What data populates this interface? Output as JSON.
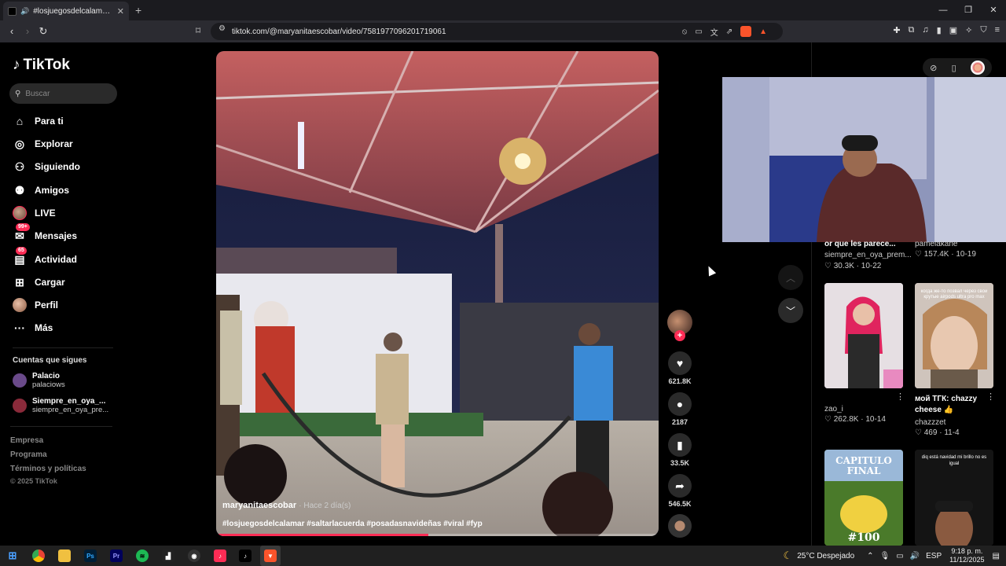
{
  "browser": {
    "tab_title": "#losjuegosdelcalamar #saltarlacuerda",
    "url": "tiktok.com/@maryanitaescobar/video/7581977096201719061",
    "shield_count": "1"
  },
  "sidebar": {
    "logo": "TikTok",
    "search_placeholder": "Buscar",
    "nav": [
      {
        "label": "Para ti",
        "icon": "home-icon"
      },
      {
        "label": "Explorar",
        "icon": "compass-icon"
      },
      {
        "label": "Siguiendo",
        "icon": "following-icon"
      },
      {
        "label": "Amigos",
        "icon": "friends-icon"
      },
      {
        "label": "LIVE",
        "icon": "live-icon"
      },
      {
        "label": "Mensajes",
        "icon": "messages-icon",
        "badge": "99+"
      },
      {
        "label": "Actividad",
        "icon": "activity-icon",
        "badge": "65"
      },
      {
        "label": "Cargar",
        "icon": "upload-icon"
      },
      {
        "label": "Perfil",
        "icon": "profile-icon"
      },
      {
        "label": "Más",
        "icon": "more-icon"
      }
    ],
    "following_title": "Cuentas que sigues",
    "following": [
      {
        "name": "Palacio",
        "handle": "palaciows"
      },
      {
        "name": "Siempre_en_oya_...",
        "handle": "siempre_en_oya_pre..."
      }
    ],
    "footer": [
      "Empresa",
      "Programa",
      "Términos y políticas"
    ],
    "copyright": "© 2025 TikTok"
  },
  "video": {
    "author": "maryanitaescobar",
    "time": "· Hace 2 día(s)",
    "caption": "#losjuegosdelcalamar #saltarlacuerda #posadasnavideñas #viral #fyp",
    "progress": 0.48
  },
  "actions": {
    "likes": "621.8K",
    "comments": "2187",
    "saves": "33.5K",
    "shares": "546.5K"
  },
  "recommended": [
    {
      "title": "or que les parece...",
      "author": "siempre_en_oya_prem...",
      "stats": "♡ 30.3K · 10-22"
    },
    {
      "title": "",
      "author": "pamelakane",
      "stats": "♡ 157.4K · 10-19"
    },
    {
      "title": "",
      "author": "zao_i",
      "stats": "♡ 262.8K · 10-14"
    },
    {
      "title": "мой ТГК: chazzy cheese 👍",
      "author": "chazzzet",
      "stats": "♡ 469 · 11-4"
    },
    {
      "thumb_text": "CAPITULO FINAL"
    },
    {
      "thumb_text": "diq está navidad mi brillo no es igual"
    }
  ],
  "thumb_captions": {
    "card4": "когда же-то позвал через свои крутые airpods ultra pro max",
    "card5_price": "100"
  },
  "taskbar": {
    "weather": "25°C  Despejado",
    "lang": "ESP",
    "time": "9:18 p. m.",
    "date": "11/12/2025"
  }
}
